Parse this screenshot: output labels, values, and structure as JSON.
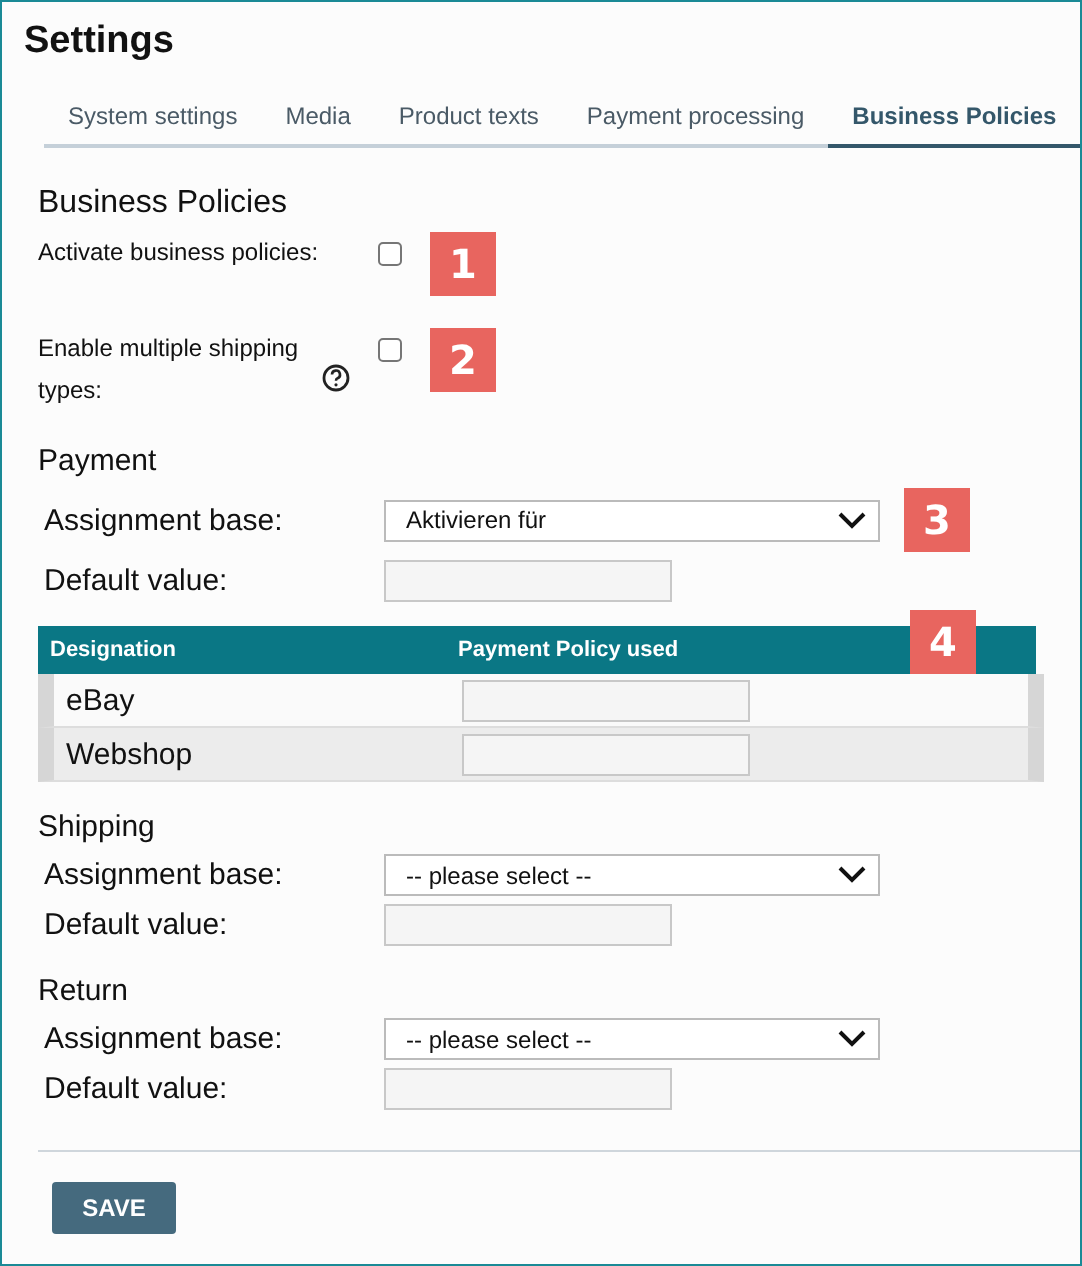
{
  "title": "Settings",
  "tabs": [
    {
      "label": "System settings",
      "selected": false
    },
    {
      "label": "Media",
      "selected": false
    },
    {
      "label": "Product texts",
      "selected": false
    },
    {
      "label": "Payment processing",
      "selected": false
    },
    {
      "label": "Business Policies",
      "selected": true
    }
  ],
  "policies": {
    "heading": "Business Policies",
    "options": [
      {
        "label": "Activate business policies:",
        "checked": false,
        "help": false,
        "marker": "1"
      },
      {
        "label": "Enable multiple shipping types:",
        "checked": false,
        "help": true,
        "marker": "2"
      }
    ]
  },
  "sections": [
    {
      "heading": "Payment",
      "assignment_label": "Assignment base:",
      "assignment_value": "Aktivieren für",
      "marker": "3",
      "default_label": "Default value:",
      "table": {
        "columns": [
          "Designation",
          "Payment Policy used"
        ],
        "marker": "4",
        "rows": [
          {
            "name": "eBay"
          },
          {
            "name": "Webshop"
          }
        ]
      }
    },
    {
      "heading": "Shipping",
      "assignment_label": "Assignment base:",
      "assignment_value": "-- please select --",
      "default_label": "Default value:"
    },
    {
      "heading": "Return",
      "assignment_label": "Assignment base:",
      "assignment_value": "-- please select --",
      "default_label": "Default value:"
    }
  ],
  "save": "SAVE"
}
